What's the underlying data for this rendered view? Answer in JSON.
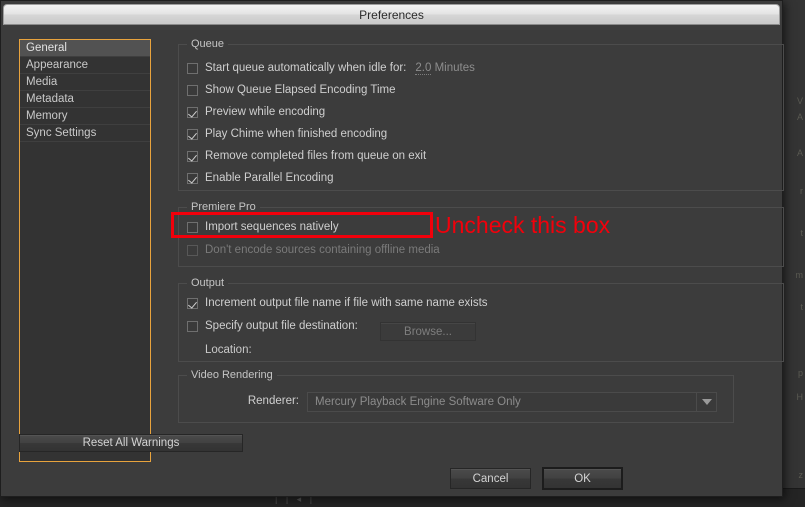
{
  "window": {
    "title": "Preferences"
  },
  "sidebar": {
    "items": [
      {
        "label": "General",
        "selected": true
      },
      {
        "label": "Appearance",
        "selected": false
      },
      {
        "label": "Media",
        "selected": false
      },
      {
        "label": "Metadata",
        "selected": false
      },
      {
        "label": "Memory",
        "selected": false
      },
      {
        "label": "Sync Settings",
        "selected": false
      }
    ]
  },
  "groups": {
    "queue": {
      "legend": "Queue",
      "items": [
        {
          "label": "Start queue automatically when idle for:",
          "checked": false,
          "disabled": false
        },
        {
          "label": "Show Queue Elapsed Encoding Time",
          "checked": false,
          "disabled": false
        },
        {
          "label": "Preview while encoding",
          "checked": true,
          "disabled": false
        },
        {
          "label": "Play Chime when finished encoding",
          "checked": true,
          "disabled": false
        },
        {
          "label": "Remove completed files from queue on exit",
          "checked": true,
          "disabled": false
        },
        {
          "label": "Enable Parallel Encoding",
          "checked": true,
          "disabled": false
        }
      ],
      "idle_value": "2.0",
      "idle_units": "Minutes"
    },
    "premiere_pro": {
      "legend": "Premiere Pro",
      "items": [
        {
          "label": "Import sequences natively",
          "checked": false,
          "disabled": false
        },
        {
          "label": "Don't encode sources containing offline media",
          "checked": false,
          "disabled": true
        }
      ]
    },
    "output": {
      "legend": "Output",
      "items": [
        {
          "label": "Increment output file name if file with same name exists",
          "checked": true,
          "disabled": false
        },
        {
          "label": "Specify output file destination:",
          "checked": false,
          "disabled": false
        }
      ],
      "browse_label": "Browse...",
      "location_label": "Location:",
      "location_value": ""
    },
    "video_rendering": {
      "legend": "Video Rendering",
      "renderer_label": "Renderer:",
      "renderer_value": "Mercury Playback Engine Software Only"
    }
  },
  "buttons": {
    "reset": "Reset All Warnings",
    "cancel": "Cancel",
    "ok": "OK"
  },
  "annotation": {
    "text": "Uncheck this box",
    "color": "#f2000b"
  },
  "colors": {
    "dialog_bg": "#3c3c3c",
    "sidebar_focus": "#e8a33d",
    "text": "#cfcfcf",
    "disabled_text": "#7a7a7a",
    "annotation_red": "#f2000b"
  }
}
